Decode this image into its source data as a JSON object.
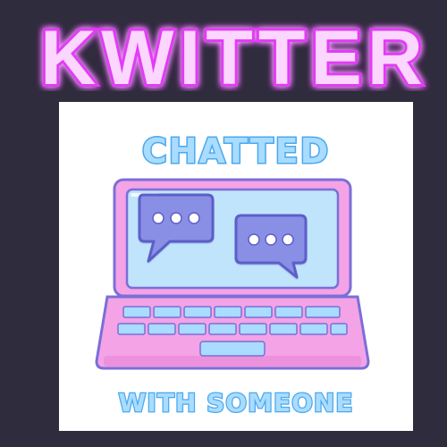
{
  "brand": {
    "title": "KWITTER",
    "glow_color": "#e33bf5",
    "fill_color": "#fbd6ff"
  },
  "badge": {
    "top_text": "CHATTED",
    "bottom_text": "WITH SOMEONE",
    "text_fill": "#a9dcff",
    "text_outline": "#4aa8ee",
    "laptop_color": "#f4a3e6",
    "screen_color": "#bfe4fb",
    "bubble_color": "#8a8fe6",
    "icons": [
      "laptop-icon",
      "chat-bubble-icon",
      "chat-bubble-icon"
    ]
  }
}
